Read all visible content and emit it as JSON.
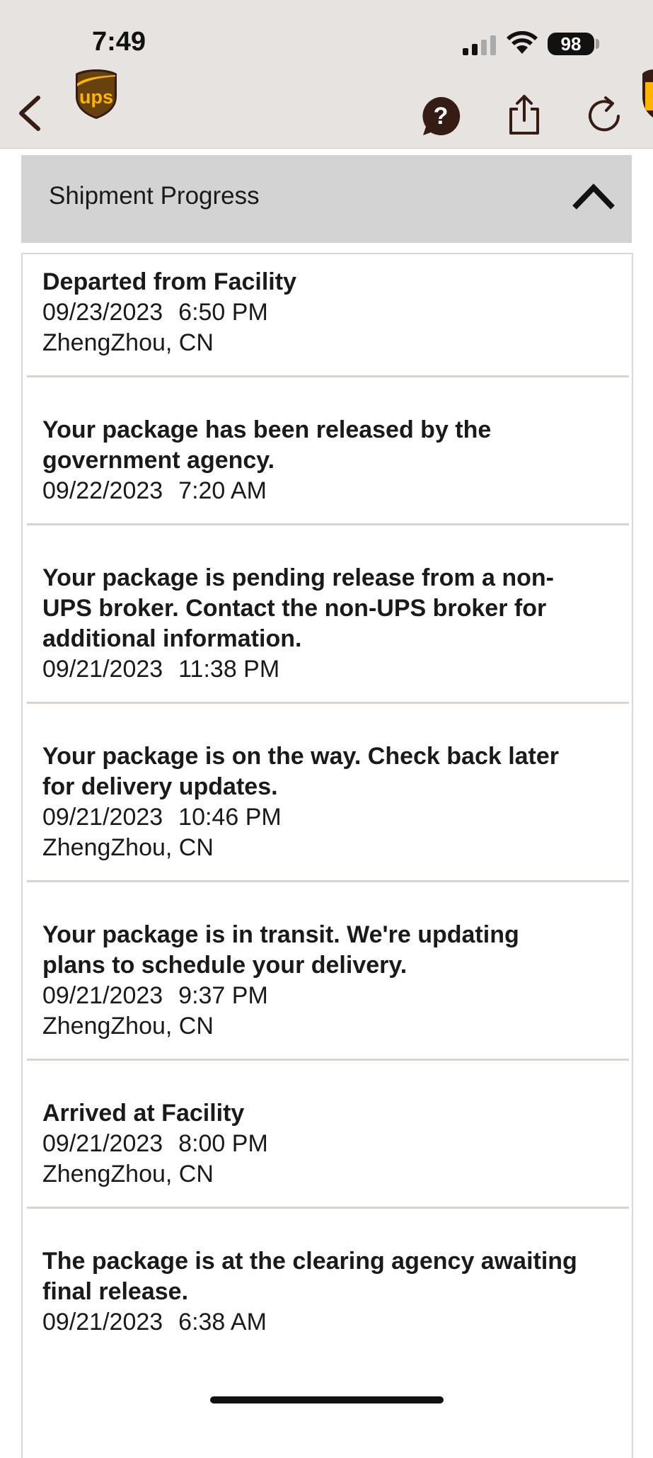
{
  "status_bar": {
    "time": "7:49",
    "battery": "98"
  },
  "colors": {
    "ups_brown": "#351c15",
    "ups_gold": "#ffb500",
    "header_bg": "#e6e3e0",
    "section_bg": "#d3d3d3"
  },
  "nav": {
    "back_icon": "chevron-left-icon",
    "logo": "ups-logo",
    "help_icon": "question-bubble-icon",
    "share_icon": "share-icon",
    "refresh_icon": "refresh-icon"
  },
  "section": {
    "title": "Shipment Progress",
    "toggle_icon": "chevron-up-icon"
  },
  "events": [
    {
      "title_lines": [
        "Departed from Facility"
      ],
      "date": "09/23/2023",
      "time": "6:50 PM",
      "location": "ZhengZhou, CN"
    },
    {
      "title_lines": [
        "Your package has been released by the",
        "government agency."
      ],
      "date": "09/22/2023",
      "time": "7:20 AM",
      "location": ""
    },
    {
      "title_lines": [
        "Your package is pending release from a non-",
        "UPS broker. Contact the non-UPS broker for",
        "additional information."
      ],
      "date": "09/21/2023",
      "time": "11:38 PM",
      "location": ""
    },
    {
      "title_lines": [
        "Your package is on the way. Check back later",
        "for delivery updates."
      ],
      "date": "09/21/2023",
      "time": "10:46 PM",
      "location": "ZhengZhou, CN"
    },
    {
      "title_lines": [
        "Your package is in transit. We're updating",
        "plans to schedule your delivery."
      ],
      "date": "09/21/2023",
      "time": "9:37 PM",
      "location": "ZhengZhou, CN"
    },
    {
      "title_lines": [
        "Arrived at Facility"
      ],
      "date": "09/21/2023",
      "time": "8:00 PM",
      "location": "ZhengZhou, CN"
    },
    {
      "title_lines": [
        "The package is at the clearing agency awaiting",
        "final release."
      ],
      "date": "09/21/2023",
      "time": "6:38 AM",
      "location": ""
    }
  ]
}
